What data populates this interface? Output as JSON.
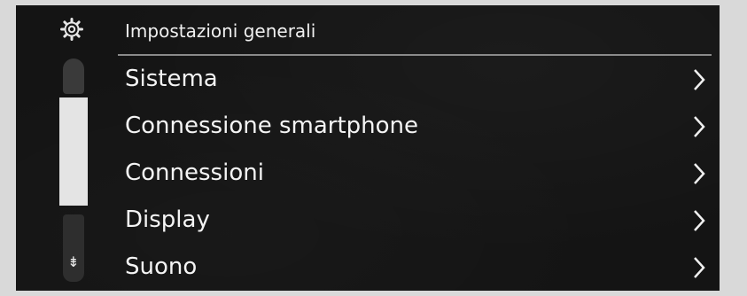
{
  "header": {
    "icon": "gear-icon",
    "title": "Impostazioni generali"
  },
  "menu": {
    "items": [
      {
        "label": "Sistema",
        "icon": "chevron-right-icon"
      },
      {
        "label": "Connessione smartphone",
        "icon": "chevron-right-icon"
      },
      {
        "label": "Connessioni",
        "icon": "chevron-right-icon"
      },
      {
        "label": "Display",
        "icon": "chevron-right-icon"
      },
      {
        "label": "Suono",
        "icon": "chevron-right-icon"
      }
    ]
  },
  "scrollbar": {
    "down_icon": "scroll-down-icon",
    "down_glyph": "⇟",
    "thumb_position": 0.35
  },
  "colors": {
    "background": "#141414",
    "text": "#f4f4f4",
    "accent": "#e4e4e4",
    "frame": "#d9d9d9"
  }
}
